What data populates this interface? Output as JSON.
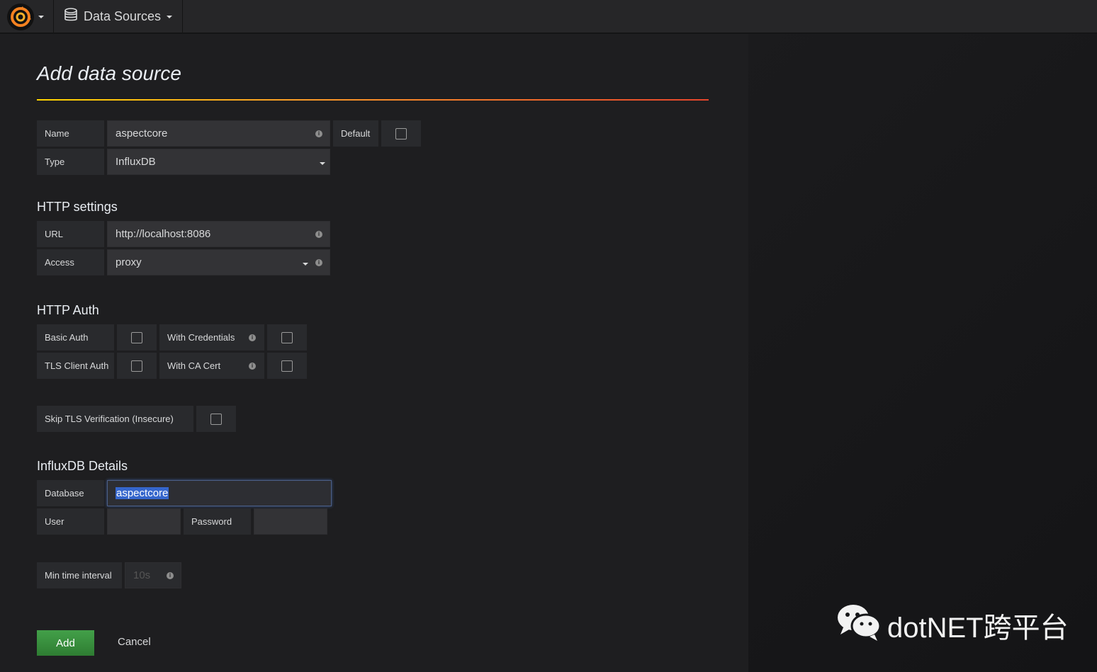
{
  "topbar": {
    "nav_label": "Data Sources"
  },
  "page": {
    "title": "Add data source"
  },
  "basic": {
    "name_label": "Name",
    "name_value": "aspectcore",
    "default_label": "Default",
    "type_label": "Type",
    "type_value": "InfluxDB"
  },
  "http_settings": {
    "heading": "HTTP settings",
    "url_label": "URL",
    "url_value": "http://localhost:8086",
    "access_label": "Access",
    "access_value": "proxy"
  },
  "http_auth": {
    "heading": "HTTP Auth",
    "basic_auth_label": "Basic Auth",
    "with_credentials_label": "With Credentials",
    "tls_client_auth_label": "TLS Client Auth",
    "with_ca_cert_label": "With CA Cert",
    "skip_tls_label": "Skip TLS Verification (Insecure)"
  },
  "influx": {
    "heading": "InfluxDB Details",
    "database_label": "Database",
    "database_value": "aspectcore",
    "user_label": "User",
    "user_value": "",
    "password_label": "Password",
    "password_value": "",
    "min_interval_label": "Min time interval",
    "min_interval_placeholder": "10s"
  },
  "actions": {
    "add_label": "Add",
    "cancel_label": "Cancel"
  },
  "watermark": {
    "text": "dotNET跨平台"
  },
  "colors": {
    "accent_gradient_start": "#ffd500",
    "accent_gradient_end": "#e5452c",
    "add_button": "#3d9142",
    "selection": "#3566cc"
  },
  "icons": {
    "logo": "grafana-logo-icon",
    "database": "database-icon",
    "info": "info-icon",
    "wechat": "wechat-icon"
  }
}
